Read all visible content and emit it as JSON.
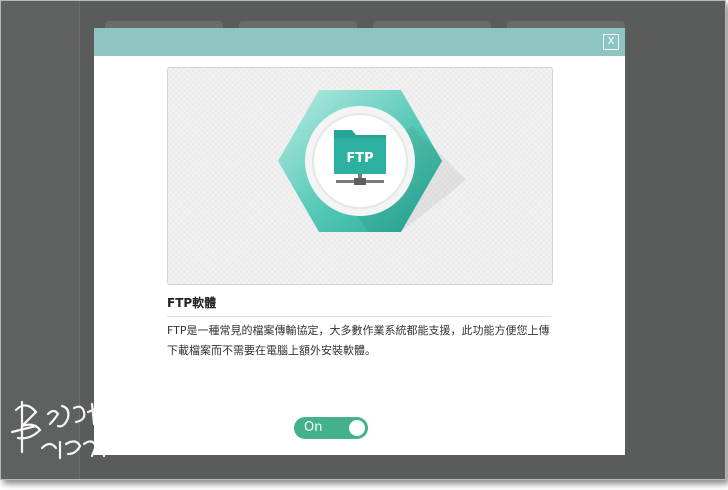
{
  "modal": {
    "close_label": "X",
    "title": "FTP軟體",
    "description": "FTP是一種常見的檔案傳輸協定，大多數作業系統都能支援，此功能方便您上傳下載檔案而不需要在電腦上額外安裝軟體。",
    "icon_label": "FTP",
    "icon": "ftp-folder-icon",
    "accent_color": "#33b3a6",
    "header_color": "#8cc5c2"
  },
  "toggle": {
    "label": "On",
    "state": "on",
    "color": "#43b28a"
  }
}
